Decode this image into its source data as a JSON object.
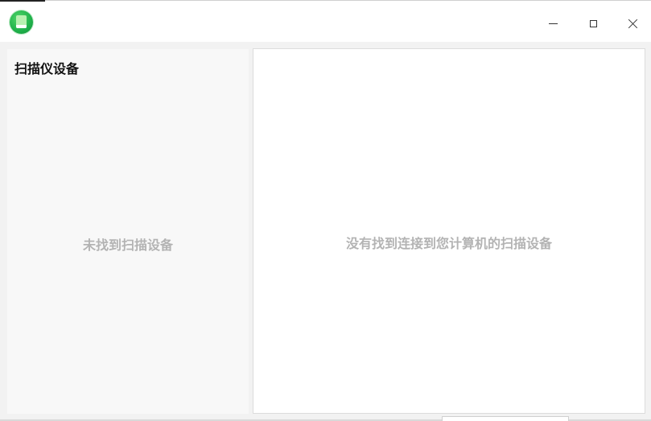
{
  "window": {
    "controls": {
      "minimize_icon": "minimize-icon",
      "maximize_icon": "maximize-icon",
      "close_icon": "close-icon"
    },
    "app_icon": "scanner-app-icon",
    "accent_color": "#1fb04a"
  },
  "left_panel": {
    "title": "扫描仪设备",
    "empty_message": "未找到扫描设备"
  },
  "right_panel": {
    "empty_message": "没有找到连接到您计算机的扫描设备"
  }
}
